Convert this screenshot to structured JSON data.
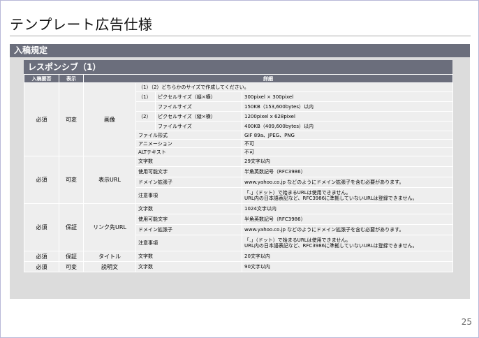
{
  "title": "テンプレート広告仕様",
  "section": "入稿規定",
  "subsection": "レスポンシブ（1）",
  "headers": {
    "h1": "入稿要否",
    "h2": "表示",
    "h3": "詳細"
  },
  "image_block": {
    "required": "必須",
    "display": "可変",
    "name": "画像",
    "intro": "（1）（2）どちらかのサイズで作成してください。",
    "s1_no": "（1）",
    "s1_pixel_label": "ピクセルサイズ（縦×横）",
    "s1_pixel_value": "300pixel × 300pixel",
    "s1_file_label": "ファイルサイズ",
    "s1_file_value": "150KB（153,600bytes）以内",
    "s2_no": "（2）",
    "s2_pixel_label": "ピクセルサイズ（縦×横）",
    "s2_pixel_value": "1200pixel x 628pixel",
    "s2_file_label": "ファイルサイズ",
    "s2_file_value": "400KB（409,600bytes）以内",
    "format_label": "ファイル形式",
    "format_value": "GIF 89a、JPEG、PNG",
    "anim_label": "アニメーション",
    "anim_value": "不可",
    "alt_label": "ALTテキスト",
    "alt_value": "不可"
  },
  "url_block": {
    "required": "必須",
    "display": "可変",
    "name": "表示URL",
    "chars_label": "文字数",
    "chars_value": "29文字以内",
    "allowed_label": "使用可能文字",
    "allowed_value": "半角英数記号（RFC3986）",
    "domain_label": "ドメイン拡張子",
    "domain_value": "www.yahoo.co.jp などのようにドメイン拡張子を含む必要があります。",
    "notes_label": "注意事項",
    "notes_line1": "「.」（ドット）で始まるURLは使用できません。",
    "notes_line2": "URL内の日本語表記など、RFC3986に準拠していないURLは登録できません。"
  },
  "link_block": {
    "required": "必須",
    "display": "保証",
    "name": "リンク先URL",
    "chars_label": "文字数",
    "chars_value": "1024文字以内",
    "allowed_label": "使用可能文字",
    "allowed_value": "半角英数記号（RFC3986）",
    "domain_label": "ドメイン拡張子",
    "domain_value": "www.yahoo.co.jp などのようにドメイン拡張子を含む必要があります。",
    "notes_label": "注意事項",
    "notes_line1": "「.」（ドット）で始まるURLは使用できません。",
    "notes_line2": "URL内の日本語表記など、RFC3986に準拠していないURLは登録できません。"
  },
  "title_block": {
    "required": "必須",
    "display": "保証",
    "name": "タイトル",
    "chars_label": "文字数",
    "chars_value": "20文字以内"
  },
  "desc_block": {
    "required": "必須",
    "display": "可変",
    "name": "説明文",
    "chars_label": "文字数",
    "chars_value": "90文字以内"
  },
  "page_number": "25"
}
